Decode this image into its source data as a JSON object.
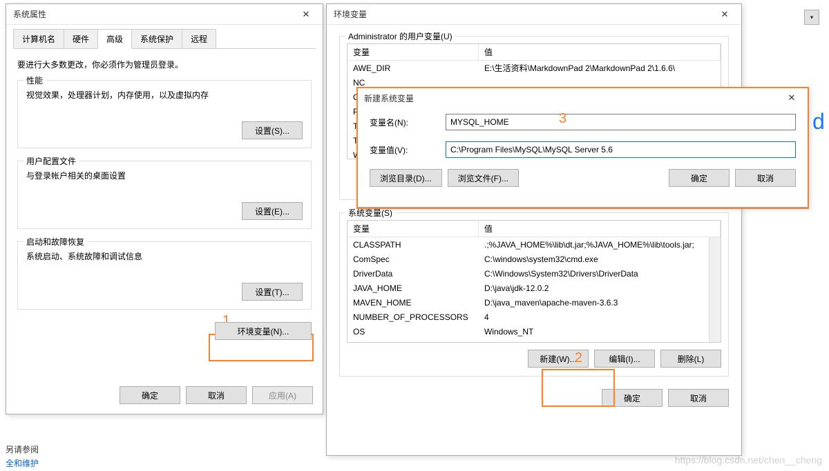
{
  "bg": {
    "see_also": "另请参阅",
    "security_link": "全和维护",
    "d_letter": "d",
    "watermark": "https://blog.csdn.net/chen__cheng"
  },
  "sys_props": {
    "title": "系统属性",
    "tabs": [
      "计算机名",
      "硬件",
      "高级",
      "系统保护",
      "远程"
    ],
    "active_tab_index": 2,
    "note": "要进行大多数更改，你必须作为管理员登录。",
    "perf_group": {
      "legend": "性能",
      "desc": "视觉效果，处理器计划，内存使用，以及虚拟内存",
      "btn": "设置(S)..."
    },
    "profile_group": {
      "legend": "用户配置文件",
      "desc": "与登录帐户相关的桌面设置",
      "btn": "设置(E)..."
    },
    "startup_group": {
      "legend": "启动和故障恢复",
      "desc": "系统启动、系统故障和调试信息",
      "btn": "设置(T)..."
    },
    "env_btn": "环境变量(N)...",
    "ok": "确定",
    "cancel": "取消",
    "apply": "应用(A)"
  },
  "env_vars": {
    "title": "环境变量",
    "user_group_legend": "Administrator 的用户变量(U)",
    "sys_group_legend": "系统变量(S)",
    "col_var": "变量",
    "col_val": "值",
    "user_vars": [
      {
        "name": "AWE_DIR",
        "value": "E:\\生活资料\\MarkdownPad 2\\MarkdownPad 2\\1.6.6\\"
      },
      {
        "name": "NC",
        "value": ""
      },
      {
        "name": "On",
        "value": ""
      },
      {
        "name": "Pat",
        "value": ""
      },
      {
        "name": "TEI",
        "value": ""
      },
      {
        "name": "TM",
        "value": ""
      },
      {
        "name": "We",
        "value": ""
      }
    ],
    "sys_vars": [
      {
        "name": "CLASSPATH",
        "value": ".;%JAVA_HOME%\\lib\\dt.jar;%JAVA_HOME%\\lib\\tools.jar;"
      },
      {
        "name": "ComSpec",
        "value": "C:\\windows\\system32\\cmd.exe"
      },
      {
        "name": "DriverData",
        "value": "C:\\Windows\\System32\\Drivers\\DriverData"
      },
      {
        "name": "JAVA_HOME",
        "value": "D:\\java\\jdk-12.0.2"
      },
      {
        "name": "MAVEN_HOME",
        "value": "D:\\java_maven\\apache-maven-3.6.3"
      },
      {
        "name": "NUMBER_OF_PROCESSORS",
        "value": "4"
      },
      {
        "name": "OS",
        "value": "Windows_NT"
      }
    ],
    "actions": {
      "new": "新建(W)...",
      "edit": "编辑(I)...",
      "delete": "删除(L)"
    },
    "ok": "确定",
    "cancel": "取消"
  },
  "new_var": {
    "title": "新建系统变量",
    "name_label": "变量名(N):",
    "name_value": "MYSQL_HOME",
    "value_label": "变量值(V):",
    "value_value": "C:\\Program Files\\MySQL\\MySQL Server 5.6",
    "browse_dir": "浏览目录(D)...",
    "browse_file": "浏览文件(F)...",
    "ok": "确定",
    "cancel": "取消"
  },
  "annotations": {
    "n1": "1",
    "n2": "2",
    "n3": "3"
  }
}
